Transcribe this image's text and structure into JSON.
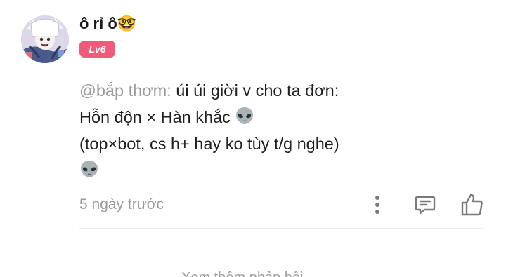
{
  "comment": {
    "username": "ô rỉ ô🤓",
    "level": "Lv6",
    "mention": "@bắp thơm:",
    "line1_text": " úi úi giời v cho ta đơn:",
    "line2_text": "Hỗn độn × Hàn khắc ",
    "line3_text": "(top×bot, cs h+ hay ko tùy t/g nghe)",
    "emoji_icon": "alien-emoji",
    "timestamp": "5 ngày trước",
    "actions": [
      "more-icon",
      "reply-icon",
      "like-icon"
    ]
  },
  "colors": {
    "badge": "#f25a7a",
    "mention": "#9a9a9a",
    "icon": "#7a7a7a"
  },
  "next_item_partial": "Xem thêm phản hồi"
}
